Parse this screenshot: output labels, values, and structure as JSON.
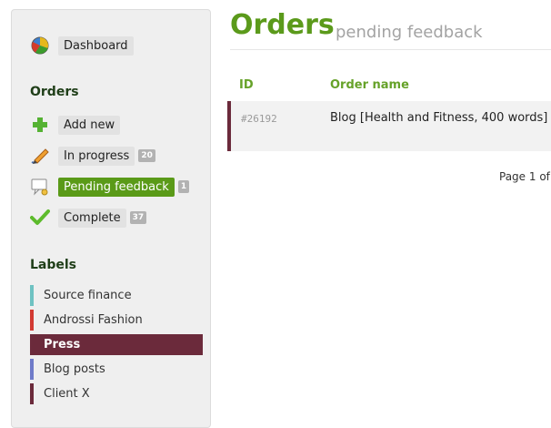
{
  "sidebar": {
    "dashboard": {
      "label": "Dashboard",
      "icon": "pie-chart-icon"
    },
    "orders_title": "Orders",
    "orders": [
      {
        "label": "Add new",
        "icon": "plus-icon",
        "count": null
      },
      {
        "label": "In progress",
        "icon": "pencil-icon",
        "count": "20"
      },
      {
        "label": "Pending feedback",
        "icon": "comment-icon",
        "count": "1",
        "active": true
      },
      {
        "label": "Complete",
        "icon": "checkmark-icon",
        "count": "37"
      }
    ],
    "labels_title": "Labels",
    "labels": [
      {
        "label": "Source finance",
        "color": "#6fc2c2"
      },
      {
        "label": "Androssi Fashion",
        "color": "#d23a32"
      },
      {
        "label": "Press",
        "color": "#6b2a3b",
        "active": true
      },
      {
        "label": "Blog posts",
        "color": "#6f7bc9"
      },
      {
        "label": "Client X",
        "color": "#6b2a3b"
      }
    ]
  },
  "main": {
    "title": "Orders",
    "subtitle": "pending feedback",
    "table": {
      "columns": [
        "ID",
        "Order name"
      ],
      "rows": [
        {
          "id": "#26192",
          "name": "Blog [Health and Fitness, 400 words]",
          "label_color": "#6b2a3b"
        }
      ]
    },
    "pagination": "Page 1 of"
  },
  "colors": {
    "accent": "#5b9a1b",
    "active_pill": "#5a9a18",
    "selected_label_bg": "#6b2a3b"
  }
}
